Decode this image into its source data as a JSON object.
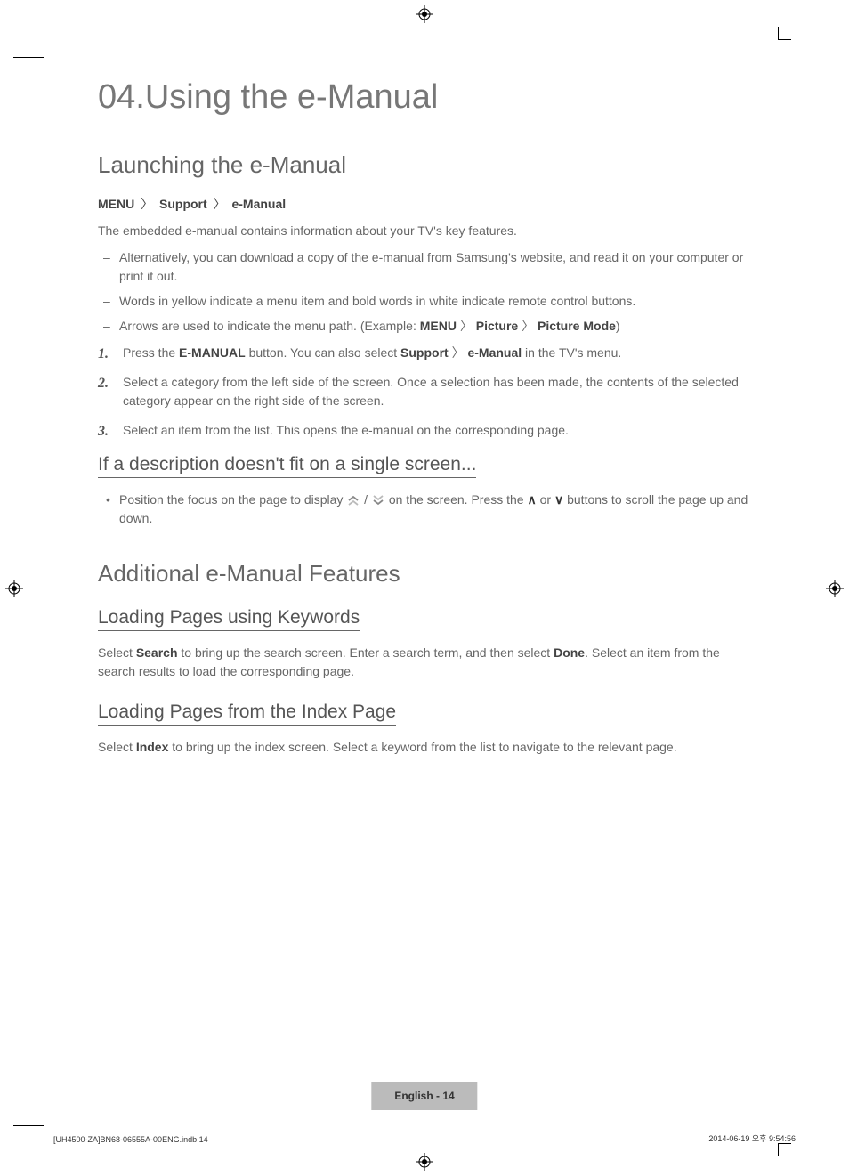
{
  "chapter": {
    "num": "04.",
    "title": "Using the e-Manual"
  },
  "s1": {
    "heading": "Launching the e-Manual",
    "path_1": "MENU",
    "path_2": "Support",
    "path_3": "e-Manual",
    "intro": "The embedded e-manual contains information about your TV's key features.",
    "d1": "Alternatively, you can download a copy of the e-manual from Samsung's website, and read it on your computer or print it out.",
    "d2": "Words in yellow indicate a menu item and bold words in white indicate remote control buttons.",
    "d3_a": "Arrows are used to indicate the menu path. (Example: ",
    "d3_m1": "MENU",
    "d3_m2": "Picture",
    "d3_m3": "Picture Mode",
    "d3_b": ")",
    "n1_a": "Press the ",
    "n1_b": "E-MANUAL",
    "n1_c": " button. You can also select ",
    "n1_d": "Support",
    "n1_e": "e-Manual",
    "n1_f": " in the TV's menu.",
    "n2": "Select a category from the left side of the screen. Once a selection has been made, the contents of the selected category appear on the right side of the screen.",
    "n3": "Select an item from the list. This opens the e-manual on the corresponding page."
  },
  "s2": {
    "heading": "If a description doesn't fit on a single screen...",
    "b1_a": "Position the focus on the page to display ",
    "b1_b": " on the screen. Press the ",
    "b1_c": " or ",
    "b1_d": " buttons to scroll the page up and down."
  },
  "s3": {
    "heading": "Additional e-Manual Features",
    "sub1": "Loading Pages using Keywords",
    "p1_a": "Select ",
    "p1_b": "Search",
    "p1_c": " to bring up the search screen. Enter a search term, and then select ",
    "p1_d": "Done",
    "p1_e": ". Select an item from the search results to load the corresponding page.",
    "sub2": "Loading Pages from the Index Page",
    "p2_a": "Select ",
    "p2_b": "Index",
    "p2_c": " to bring up the index screen. Select a keyword from the list to navigate to the relevant page."
  },
  "footer": {
    "badge": "English - 14",
    "left": "[UH4500-ZA]BN68-06555A-00ENG.indb   14",
    "right": "2014-06-19   오후 9:54:56"
  }
}
